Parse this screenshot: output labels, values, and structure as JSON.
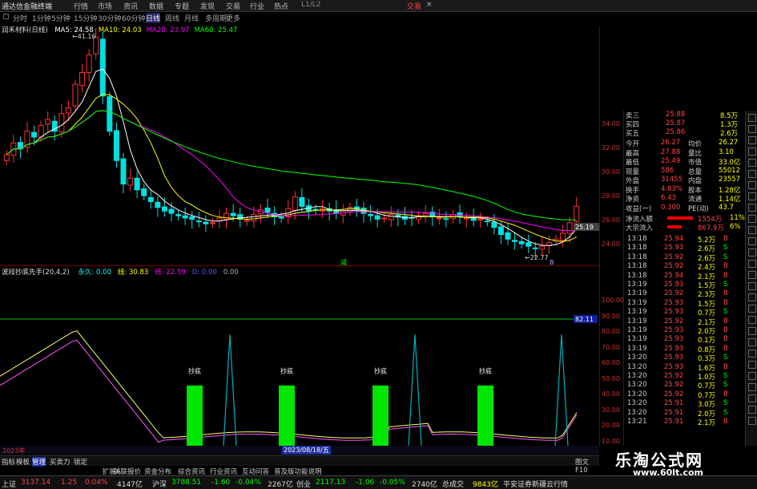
{
  "app": {
    "title": "通达信金融终端",
    "menus": [
      "行情",
      "市场",
      "资讯",
      "数据",
      "专题",
      "发现",
      "交易",
      "行业",
      "热点"
    ],
    "version": "L1/L2",
    "trade_label": "交易",
    "close_glyph": "×"
  },
  "periods": [
    "分时",
    "1分钟",
    "5分钟",
    "15分钟",
    "30分钟",
    "60分钟",
    "日线",
    "周线",
    "月线",
    "多周期",
    "更多"
  ],
  "selected_period": "日线",
  "stock": {
    "name": "润禾材料(日线)",
    "ma": [
      {
        "label": "MA5: 24.58",
        "color": "#ffffff"
      },
      {
        "label": "MA10: 24.03",
        "color": "#ffff00"
      },
      {
        "label": "MA20: 23.97",
        "color": "#ff00ff"
      },
      {
        "label": "MA60: 25.47",
        "color": "#00ff00"
      }
    ],
    "high_label": "41.16",
    "low_label": "22.77",
    "last_label": "25.19",
    "sell_flag": "减",
    "buy_flag": "B"
  },
  "indicator": {
    "header": "波段抄底先手(20,4,2)",
    "items": [
      {
        "label": "永久: 0.00",
        "color": "#00ffff"
      },
      {
        "label": "线: 30.83",
        "color": "#ffff00"
      },
      {
        "label": "线: 22.59",
        "color": "#ff00ff"
      },
      {
        "label": "D: 0.00",
        "color": "#5555ff"
      },
      {
        "label": "0.00",
        "color": "#aaaaaa"
      }
    ],
    "signal_label": "抄底",
    "marker_value": "82.11",
    "date_label": "2023/08/18/五"
  },
  "price_axis": [
    "34.00",
    "32.00",
    "30.00",
    "28.00",
    "26.00",
    "24.00"
  ],
  "ind_axis": [
    "100.00",
    "90.00",
    "80.00",
    "70.00",
    "60.00",
    "50.00",
    "40.00",
    "30.00",
    "20.00",
    "10.00"
  ],
  "quote": {
    "asks": [
      {
        "label": "卖三",
        "price": "25.88",
        "vol": "8.5万"
      },
      {
        "label": "买四",
        "price": "25.87",
        "vol": "1.3万"
      },
      {
        "label": "买五",
        "price": "25.86",
        "vol": "2.6万"
      }
    ],
    "stats": [
      {
        "l1": "今开",
        "v1": "26.27",
        "l2": "均价",
        "v2": "26.27"
      },
      {
        "l1": "最高",
        "v1": "27.88",
        "l2": "量比",
        "v2": "3.10"
      },
      {
        "l1": "最低",
        "v1": "25.49",
        "l2": "市值",
        "v2": "33.0亿"
      },
      {
        "l1": "现量",
        "v1": "586",
        "l2": "总量",
        "v2": "55012"
      },
      {
        "l1": "外盘",
        "v1": "31455",
        "l2": "内盘",
        "v2": "23557"
      },
      {
        "l1": "换手",
        "v1": "4.83%",
        "l2": "股本",
        "v2": "1.28亿"
      },
      {
        "l1": "净资",
        "v1": "6.43",
        "l2": "流通",
        "v2": "1.14亿"
      },
      {
        "l1": "收益(一)",
        "v1": "0.300",
        "l2": "PE(动)",
        "v2": "43.7"
      }
    ],
    "flows": [
      {
        "label": "净流入额",
        "value": "1554万",
        "pct": "11%"
      },
      {
        "label": "大宗流入",
        "value": "867.9万",
        "pct": "6%"
      }
    ],
    "ticks": [
      {
        "t": "13:18",
        "p": "25.94",
        "v": "5.2万",
        "s": "B"
      },
      {
        "t": "13:18",
        "p": "25.93",
        "v": "2.6万",
        "s": "S"
      },
      {
        "t": "13:18",
        "p": "25.92",
        "v": "2.6万",
        "s": "S"
      },
      {
        "t": "13:18",
        "p": "25.92",
        "v": "2.4万",
        "s": "B"
      },
      {
        "t": "13:18",
        "p": "25.94",
        "v": "2.1万",
        "s": "B"
      },
      {
        "t": "13:19",
        "p": "25.93",
        "v": "1.5万",
        "s": "S"
      },
      {
        "t": "13:19",
        "p": "25.92",
        "v": "2.3万",
        "s": "B"
      },
      {
        "t": "13:19",
        "p": "25.93",
        "v": "1.5万",
        "s": "B"
      },
      {
        "t": "13:19",
        "p": "25.93",
        "v": "0.7万",
        "s": "S"
      },
      {
        "t": "13:19",
        "p": "25.92",
        "v": "2.1万",
        "s": "B"
      },
      {
        "t": "13:19",
        "p": "25.93",
        "v": "2.0万",
        "s": "B"
      },
      {
        "t": "13:19",
        "p": "25.93",
        "v": "0.1万",
        "s": "B"
      },
      {
        "t": "13:19",
        "p": "25.93",
        "v": "0.8万",
        "s": "B"
      },
      {
        "t": "13:20",
        "p": "25.93",
        "v": "0.3万",
        "s": "S"
      },
      {
        "t": "13:20",
        "p": "25.93",
        "v": "1.6万",
        "s": "B"
      },
      {
        "t": "13:20",
        "p": "25.92",
        "v": "1.0万",
        "s": "S"
      },
      {
        "t": "13:20",
        "p": "25.92",
        "v": "0.7万",
        "s": "S"
      },
      {
        "t": "13:20",
        "p": "25.92",
        "v": "0.7万",
        "s": "B"
      },
      {
        "t": "13:20",
        "p": "25.91",
        "v": "3.0万",
        "s": "S"
      },
      {
        "t": "13:20",
        "p": "25.91",
        "v": "2.0万",
        "s": "S"
      },
      {
        "t": "13:21",
        "p": "25.91",
        "v": "2.1万",
        "s": "B"
      }
    ]
  },
  "bottom_tabs": [
    "指标",
    "模板",
    "管理",
    "买卖力",
    "锁定",
    "扩展A",
    "关联报价",
    "资金分布",
    "综合资讯",
    "行业资讯",
    "互动问答",
    "普及版功能说明"
  ],
  "bottom_right": "图文 F10",
  "status": {
    "idx1": {
      "name": "上证",
      "value": "3137.14",
      "chg": "1.25",
      "pct": "0.04%",
      "amt": "4147亿"
    },
    "idx2": {
      "name": "沪深",
      "value": "3788.51",
      "chg": "-1.60",
      "pct": "-0.04%",
      "amt": "2267亿"
    },
    "idx3": {
      "name": "创业",
      "value": "2117.13",
      "chg": "-1.06",
      "pct": "-0.05%",
      "amt": "2740亿"
    },
    "total_label": "总成交",
    "total": "9843亿",
    "broker": "平安证券新疆云行情"
  },
  "watermark": {
    "title": "乐淘公式网",
    "url": "www.60lt.com"
  },
  "year_label": "2023年"
}
